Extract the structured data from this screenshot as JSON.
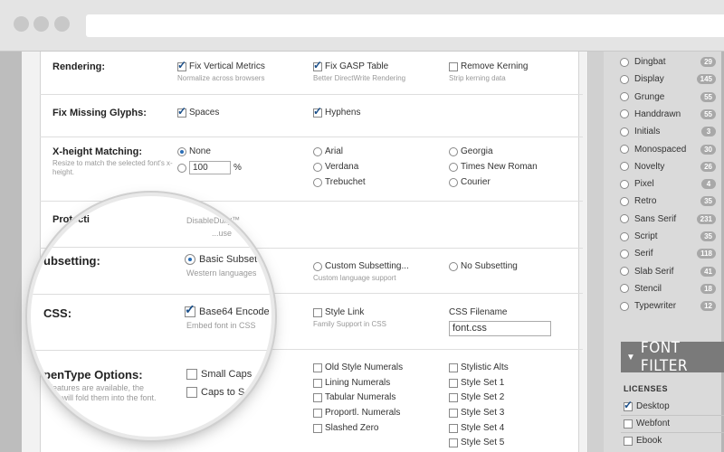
{
  "rendering": {
    "label": "Rendering:",
    "options": [
      {
        "label": "Fix Vertical Metrics",
        "sub": "Normalize across browsers",
        "checked": true
      },
      {
        "label": "Fix GASP Table",
        "sub": "Better DirectWrite Rendering",
        "checked": true
      },
      {
        "label": "Remove Kerning",
        "sub": "Strip kerning data",
        "checked": false
      }
    ]
  },
  "missing_glyphs": {
    "label": "Fix Missing Glyphs:",
    "options": [
      {
        "label": "Spaces",
        "checked": true
      },
      {
        "label": "Hyphens",
        "checked": true
      }
    ]
  },
  "xheight": {
    "label": "X-height Matching:",
    "sub": "Resize to match the selected font's x-height.",
    "none": "None",
    "percent_value": "100",
    "percent_sign": "%",
    "fonts": [
      "Arial",
      "Verdana",
      "Trebuchet",
      "Georgia",
      "Times New Roman",
      "Courier"
    ]
  },
  "protection": {
    "label": "Protecti",
    "option": "DisableDully™",
    "sub": "...use"
  },
  "subsetting": {
    "label": "ubsetting:",
    "basic": "Basic Subset",
    "basic_sub": "Western languages",
    "custom": "Custom Subsetting...",
    "custom_sub": "Custom language support",
    "none": "No Subsetting"
  },
  "css": {
    "label": "CSS:",
    "base64": "Base64 Encode",
    "base64_sub": "Embed font in CSS",
    "style_link": "Style Link",
    "style_link_sub": "Family Support in CSS",
    "filename_label": "CSS Filename",
    "filename_value": "font.css"
  },
  "opentype": {
    "label": "penType Options:",
    "sub1": "...features are available, the",
    "sub2": "...tor will fold them into the font.",
    "small_caps": "Small Caps",
    "caps_to": "Caps to S",
    "col2": [
      "Old Style Numerals",
      "Lining Numerals",
      "Tabular Numerals",
      "Proportl. Numerals",
      "Slashed Zero"
    ],
    "col3": [
      "Stylistic Alts",
      "Style Set 1",
      "Style Set 2",
      "Style Set 3",
      "Style Set 4",
      "Style Set 5"
    ]
  },
  "sidebar": {
    "categories": [
      {
        "name": "Dingbat",
        "count": "29"
      },
      {
        "name": "Display",
        "count": "145"
      },
      {
        "name": "Grunge",
        "count": "55"
      },
      {
        "name": "Handdrawn",
        "count": "55"
      },
      {
        "name": "Initials",
        "count": "3"
      },
      {
        "name": "Monospaced",
        "count": "30"
      },
      {
        "name": "Novelty",
        "count": "26"
      },
      {
        "name": "Pixel",
        "count": "4"
      },
      {
        "name": "Retro",
        "count": "35"
      },
      {
        "name": "Sans Serif",
        "count": "231"
      },
      {
        "name": "Script",
        "count": "35"
      },
      {
        "name": "Serif",
        "count": "118"
      },
      {
        "name": "Slab Serif",
        "count": "41"
      },
      {
        "name": "Stencil",
        "count": "18"
      },
      {
        "name": "Typewriter",
        "count": "12"
      }
    ],
    "filter_title": "FONT FILTER",
    "licenses_title": "LICENSES",
    "licenses": [
      {
        "label": "Desktop",
        "checked": true
      },
      {
        "label": "Webfont",
        "checked": false
      },
      {
        "label": "Ebook",
        "checked": false
      }
    ]
  }
}
